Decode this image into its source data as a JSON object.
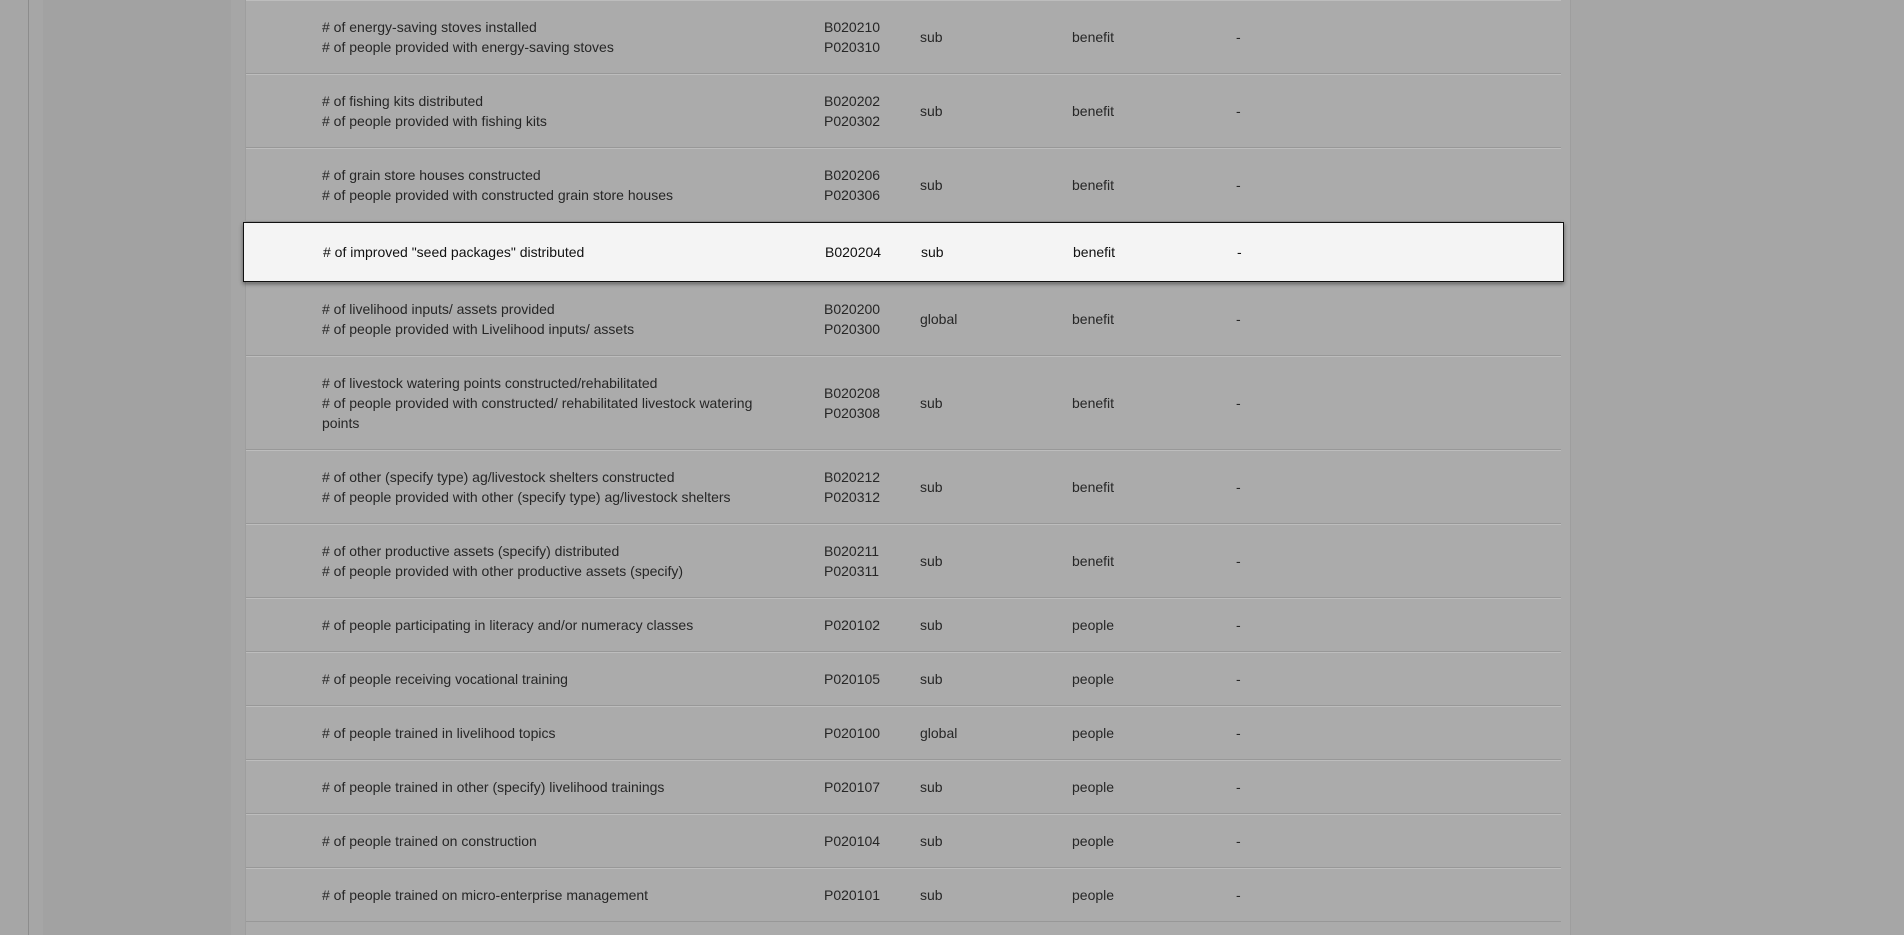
{
  "rows": [
    {
      "names": [
        "# of energy-saving stoves installed",
        "# of people provided with energy-saving stoves"
      ],
      "codes": [
        "B020210",
        "P020310"
      ],
      "scope": "sub",
      "type": "benefit",
      "extra": "-"
    },
    {
      "names": [
        "# of fishing kits distributed",
        "# of people provided with fishing kits"
      ],
      "codes": [
        "B020202",
        "P020302"
      ],
      "scope": "sub",
      "type": "benefit",
      "extra": "-"
    },
    {
      "names": [
        "# of grain store houses constructed",
        "# of people provided with constructed grain store houses"
      ],
      "codes": [
        "B020206",
        "P020306"
      ],
      "scope": "sub",
      "type": "benefit",
      "extra": "-"
    },
    {
      "names": [
        "# of improved \"seed packages\" distributed"
      ],
      "codes": [
        "B020204"
      ],
      "scope": "sub",
      "type": "benefit",
      "extra": "-",
      "selected": true
    },
    {
      "names": [
        "# of livelihood inputs/ assets provided",
        "# of people provided with Livelihood inputs/ assets"
      ],
      "codes": [
        "B020200",
        "P020300"
      ],
      "scope": "global",
      "type": "benefit",
      "extra": "-"
    },
    {
      "names": [
        "# of livestock watering points constructed/rehabilitated",
        "# of people provided with constructed/ rehabilitated livestock watering points"
      ],
      "codes": [
        "B020208",
        "P020308"
      ],
      "scope": "sub",
      "type": "benefit",
      "extra": "-"
    },
    {
      "names": [
        "# of other (specify type) ag/livestock shelters constructed",
        "# of people provided with other (specify type) ag/livestock shelters"
      ],
      "codes": [
        "B020212",
        "P020312"
      ],
      "scope": "sub",
      "type": "benefit",
      "extra": "-"
    },
    {
      "names": [
        "# of other productive assets (specify) distributed",
        "# of people provided with other productive assets (specify)"
      ],
      "codes": [
        "B020211",
        "P020311"
      ],
      "scope": "sub",
      "type": "benefit",
      "extra": "-"
    },
    {
      "names": [
        "# of people participating in literacy and/or numeracy classes"
      ],
      "codes": [
        "P020102"
      ],
      "scope": "sub",
      "type": "people",
      "extra": "-"
    },
    {
      "names": [
        "# of people receiving vocational training"
      ],
      "codes": [
        "P020105"
      ],
      "scope": "sub",
      "type": "people",
      "extra": "-"
    },
    {
      "names": [
        "# of people trained in livelihood topics"
      ],
      "codes": [
        "P020100"
      ],
      "scope": "global",
      "type": "people",
      "extra": "-"
    },
    {
      "names": [
        "# of people trained in other (specify) livelihood trainings"
      ],
      "codes": [
        "P020107"
      ],
      "scope": "sub",
      "type": "people",
      "extra": "-"
    },
    {
      "names": [
        "# of people trained on construction"
      ],
      "codes": [
        "P020104"
      ],
      "scope": "sub",
      "type": "people",
      "extra": "-"
    },
    {
      "names": [
        "# of people trained on micro-enterprise management"
      ],
      "codes": [
        "P020101"
      ],
      "scope": "sub",
      "type": "people",
      "extra": "-"
    }
  ]
}
